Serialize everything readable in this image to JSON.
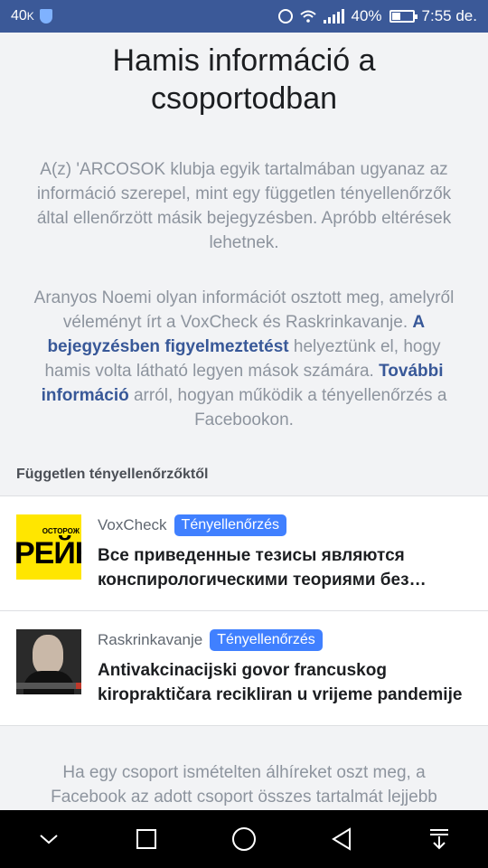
{
  "status_bar": {
    "left_text": "40",
    "left_small": "K",
    "battery": "40%",
    "time": "7:55 de."
  },
  "page": {
    "title": "Hamis információ a csoportodban",
    "paragraph1": "A(z) 'ARCOSOK klubja egyik tartalmában ugyanaz az információ szerepel, mint egy független tényellenőrzők által ellenőrzött másik bejegyzésben. Apróbb eltérések lehetnek.",
    "paragraph2": {
      "part1": "Aranyos Noemi olyan információt osztott meg, amelyről véleményt írt a VoxCheck és Raskrinkavanje. ",
      "link1": "A bejegyzésben figyelmeztetést",
      "part2": " helyeztünk el, hogy hamis volta látható legyen mások számára. ",
      "link2": "További információ",
      "part3": " arról, hogyan működik a tényellenőrzés a Facebookon."
    },
    "section_header": "Független tényellenőrzőktől",
    "items": [
      {
        "source": "VoxCheck",
        "badge": "Tényellenőrzés",
        "headline": "Все приведенные тезисы являются конспирологическими теориями без оснований",
        "thumb_small": "ОСТОРОЖ",
        "thumb_big": "РЕЙКИ"
      },
      {
        "source": "Raskrinkavanje",
        "badge": "Tényellenőrzés",
        "headline": "Antivakcinacijski govor francuskog kiropraktičara recikliran u vrijeme pandemije"
      }
    ],
    "paragraph3": "Ha egy csoport ismételten álhíreket oszt meg, a Facebook az adott csoport összes tartalmát lejjebb helyezheti a hírfolyamban, ami esetleg"
  },
  "colors": {
    "status_bar": "#3b5998",
    "link": "#385898",
    "badge": "#4080ff"
  },
  "nav_icons": [
    "chevron-down-icon",
    "square-icon",
    "circle-icon",
    "back-triangle-icon",
    "notification-shade-icon"
  ]
}
